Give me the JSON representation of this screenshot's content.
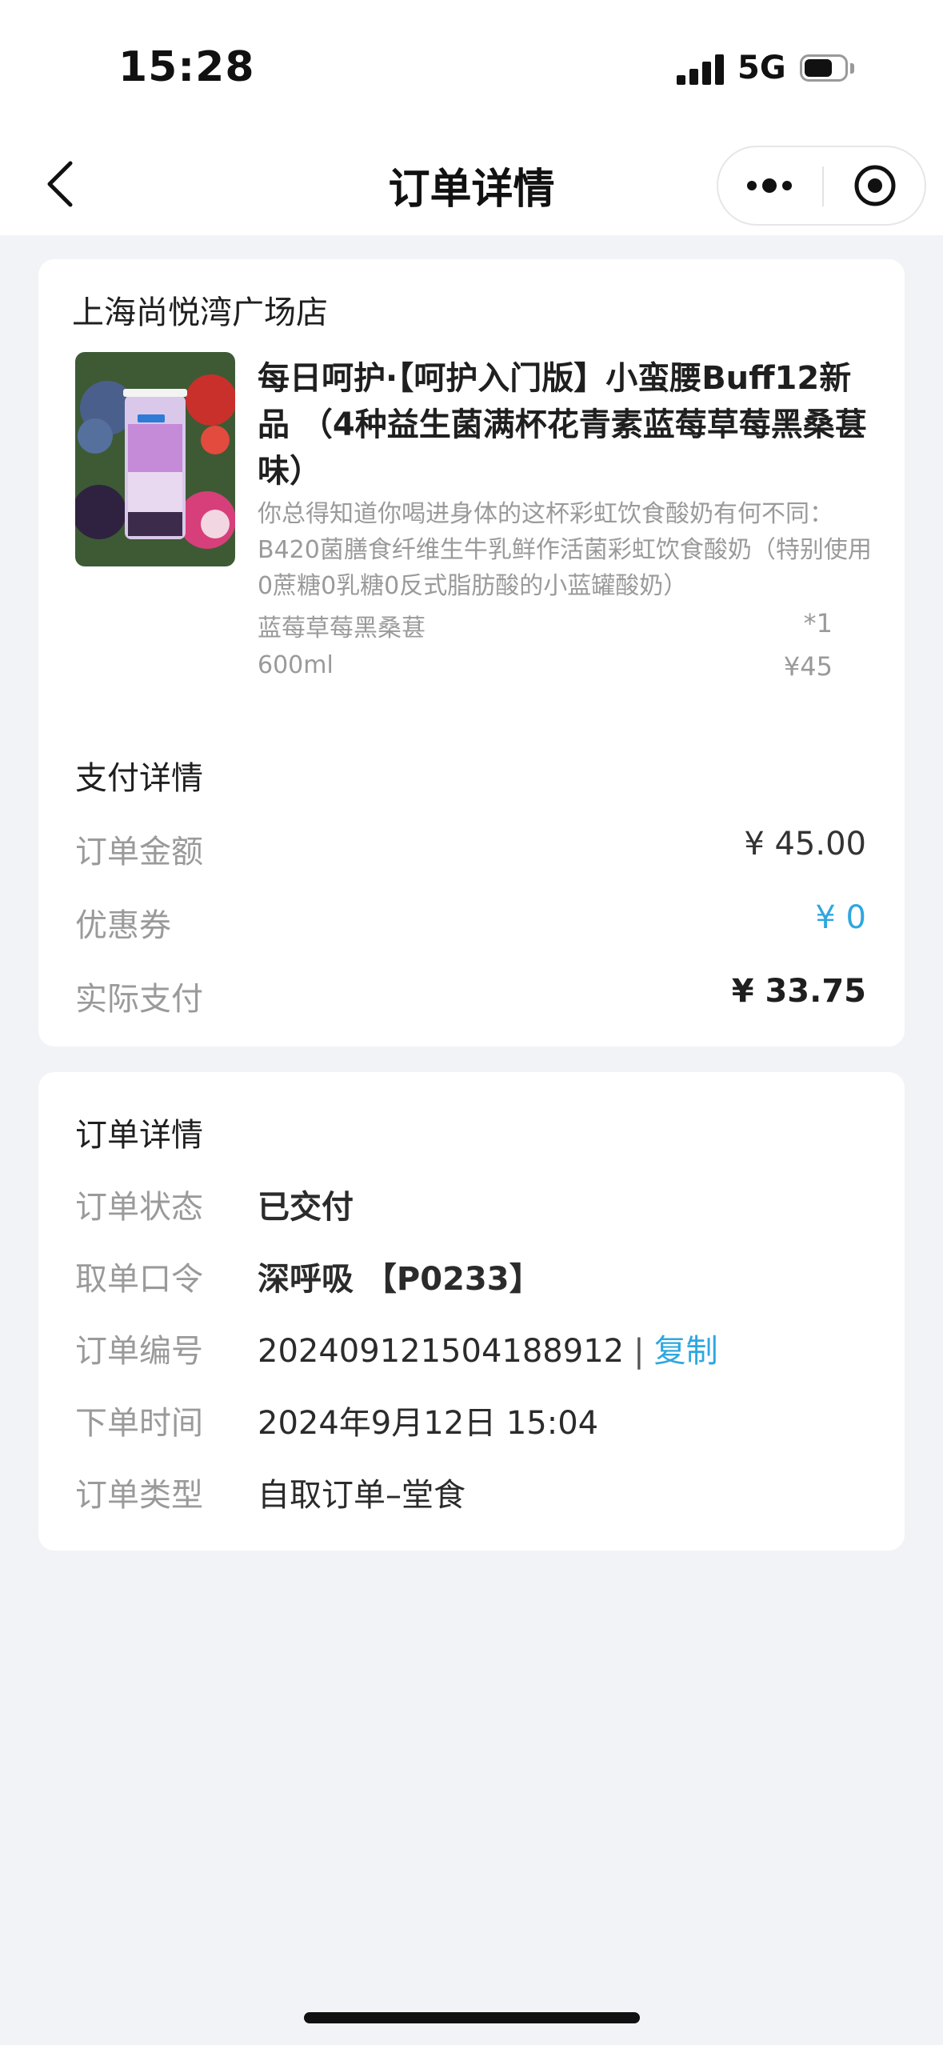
{
  "status_bar": {
    "time": "15:28",
    "network": "5G"
  },
  "nav": {
    "title": "订单详情"
  },
  "store": {
    "name": "上海尚悦湾广场店",
    "product": {
      "title": "每日呵护·【呵护入门版】小蛮腰Buff12新品 （4种益生菌满杯花青素蓝莓草莓黑桑葚味）",
      "description": "你总得知道你喝进身体的这杯彩虹饮食酸奶有何不同：B420菌膳食纤维生牛乳鲜作活菌彩虹饮食酸奶（特别使用0蔗糖0乳糖0反式脂肪酸的小蓝罐酸奶）",
      "spec": "蓝莓草莓黑桑葚",
      "volume": "600ml",
      "quantity": "*1",
      "price": "¥45"
    }
  },
  "payment": {
    "title": "支付详情",
    "rows": [
      {
        "label": "订单金额",
        "value": "¥ 45.00"
      },
      {
        "label": "优惠券",
        "value": "¥ 0"
      },
      {
        "label": "实际支付",
        "value": "¥ 33.75"
      }
    ]
  },
  "order": {
    "title": "订单详情",
    "status_label": "订单状态",
    "status_value": "已交付",
    "pickup_label": "取单口令",
    "pickup_value": "深呼吸 【P0233】",
    "number_label": "订单编号",
    "number_value": "202409121504188912",
    "copy_label": "复制",
    "time_label": "下单时间",
    "time_value": "2024年9月12日 15:04",
    "type_label": "订单类型",
    "type_value": "自取订单–堂食"
  },
  "colors": {
    "accent": "#2ea7e0",
    "background": "#f2f3f7"
  },
  "icons": [
    "back-icon",
    "more-icon",
    "target-icon",
    "signal-icon",
    "battery-icon"
  ]
}
